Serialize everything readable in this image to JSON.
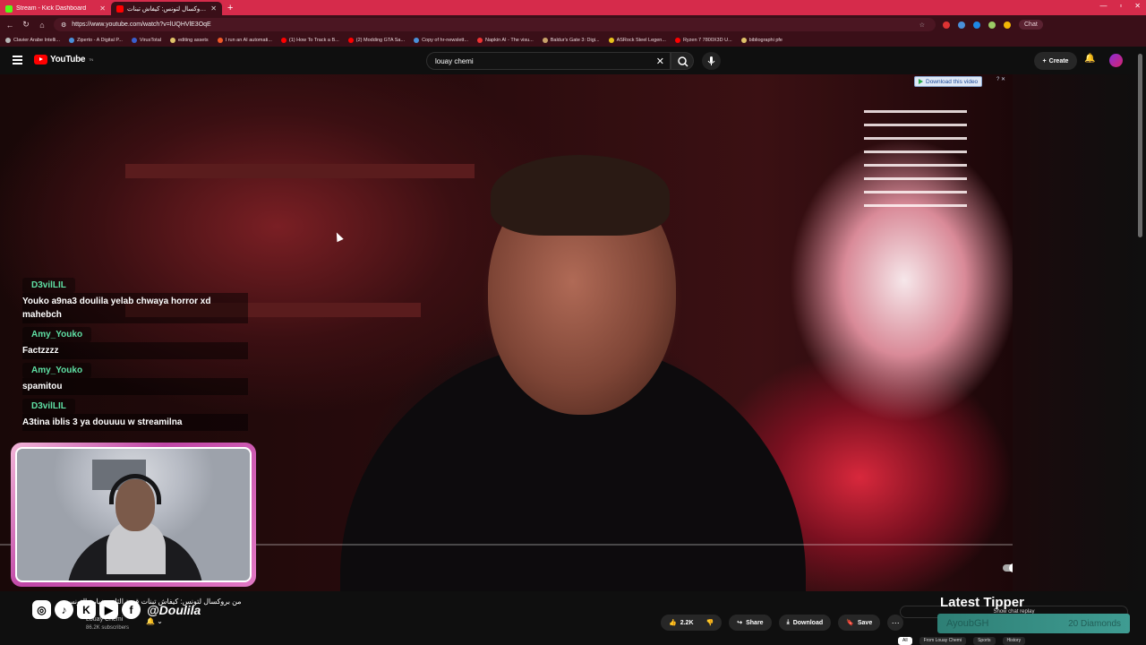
{
  "browser": {
    "tabs": [
      {
        "label": "Stream - Kick Dashboard",
        "favicon_color": "#53fc18"
      },
      {
        "label": "من بروكسال لتونس: كيفاش تبنات",
        "favicon_color": "#ff0000"
      }
    ],
    "new_tab": "+",
    "url": "https://www.youtube.com/watch?v=lUQHVlE3OqE",
    "chat_button": "Chat",
    "bookmarks": [
      {
        "label": "Clavier Arabe Intelli...",
        "color": "#b7b7b7"
      },
      {
        "label": "Ziperto - A Digital P...",
        "color": "#4a90d9"
      },
      {
        "label": "VirusTotal",
        "color": "#3a5fcd"
      },
      {
        "label": "editing assets",
        "color": "#e0c36a"
      },
      {
        "label": "I run an AI automati...",
        "color": "#f05a28"
      },
      {
        "label": "(1) How To Track a B...",
        "color": "#ff0000"
      },
      {
        "label": "(2) Modding GTA Sa...",
        "color": "#ff0000"
      },
      {
        "label": "Copy of hr-newslett...",
        "color": "#4a90d9"
      },
      {
        "label": "Napkin AI - The visu...",
        "color": "#e33"
      },
      {
        "label": "Baldur's Gate 3: Digi...",
        "color": "#c8a26a"
      },
      {
        "label": "ASRock Steel Legen...",
        "color": "#e8c21c"
      },
      {
        "label": "Ryzen 7 7800X3D U...",
        "color": "#ff0000"
      },
      {
        "label": "bibliographi pfe",
        "color": "#e0c36a"
      }
    ]
  },
  "youtube": {
    "logo_text": "YouTube",
    "logo_region": "TN",
    "search_query": "louay chemi",
    "create_label": "Create"
  },
  "video": {
    "download_badge": "Download this video"
  },
  "chat": {
    "messages": [
      {
        "user": "D3vilLIL",
        "text": "Youko a9na3 doulila yelab chwaya horror xd mahebch"
      },
      {
        "user": "Amy_Youko",
        "text": "Factzzzz"
      },
      {
        "user": "Amy_Youko",
        "text": "spamitou"
      },
      {
        "user": "D3vilLIL",
        "text": "A3tina iblis 3 ya douuuu w streamilna"
      }
    ]
  },
  "overlay": {
    "handle": "@Doulila",
    "latest_tipper_label": "Latest Tipper",
    "tipper_name": "AyoubGH",
    "tipper_amount": "20 Diamonds"
  },
  "video_info": {
    "title": "من بروكسال لتونس: كيفاش تبنات قصة الثاني خيارة التونسي",
    "channel": "Louay Chemi",
    "subscribers": "86.2K subscribers",
    "likes": "2.2K",
    "share_label": "Share",
    "download_label": "Download",
    "save_label": "Save",
    "show_chat_replay": "Show chat replay",
    "chips": [
      "All",
      "From Louay Chemi",
      "Sports",
      "History"
    ]
  }
}
